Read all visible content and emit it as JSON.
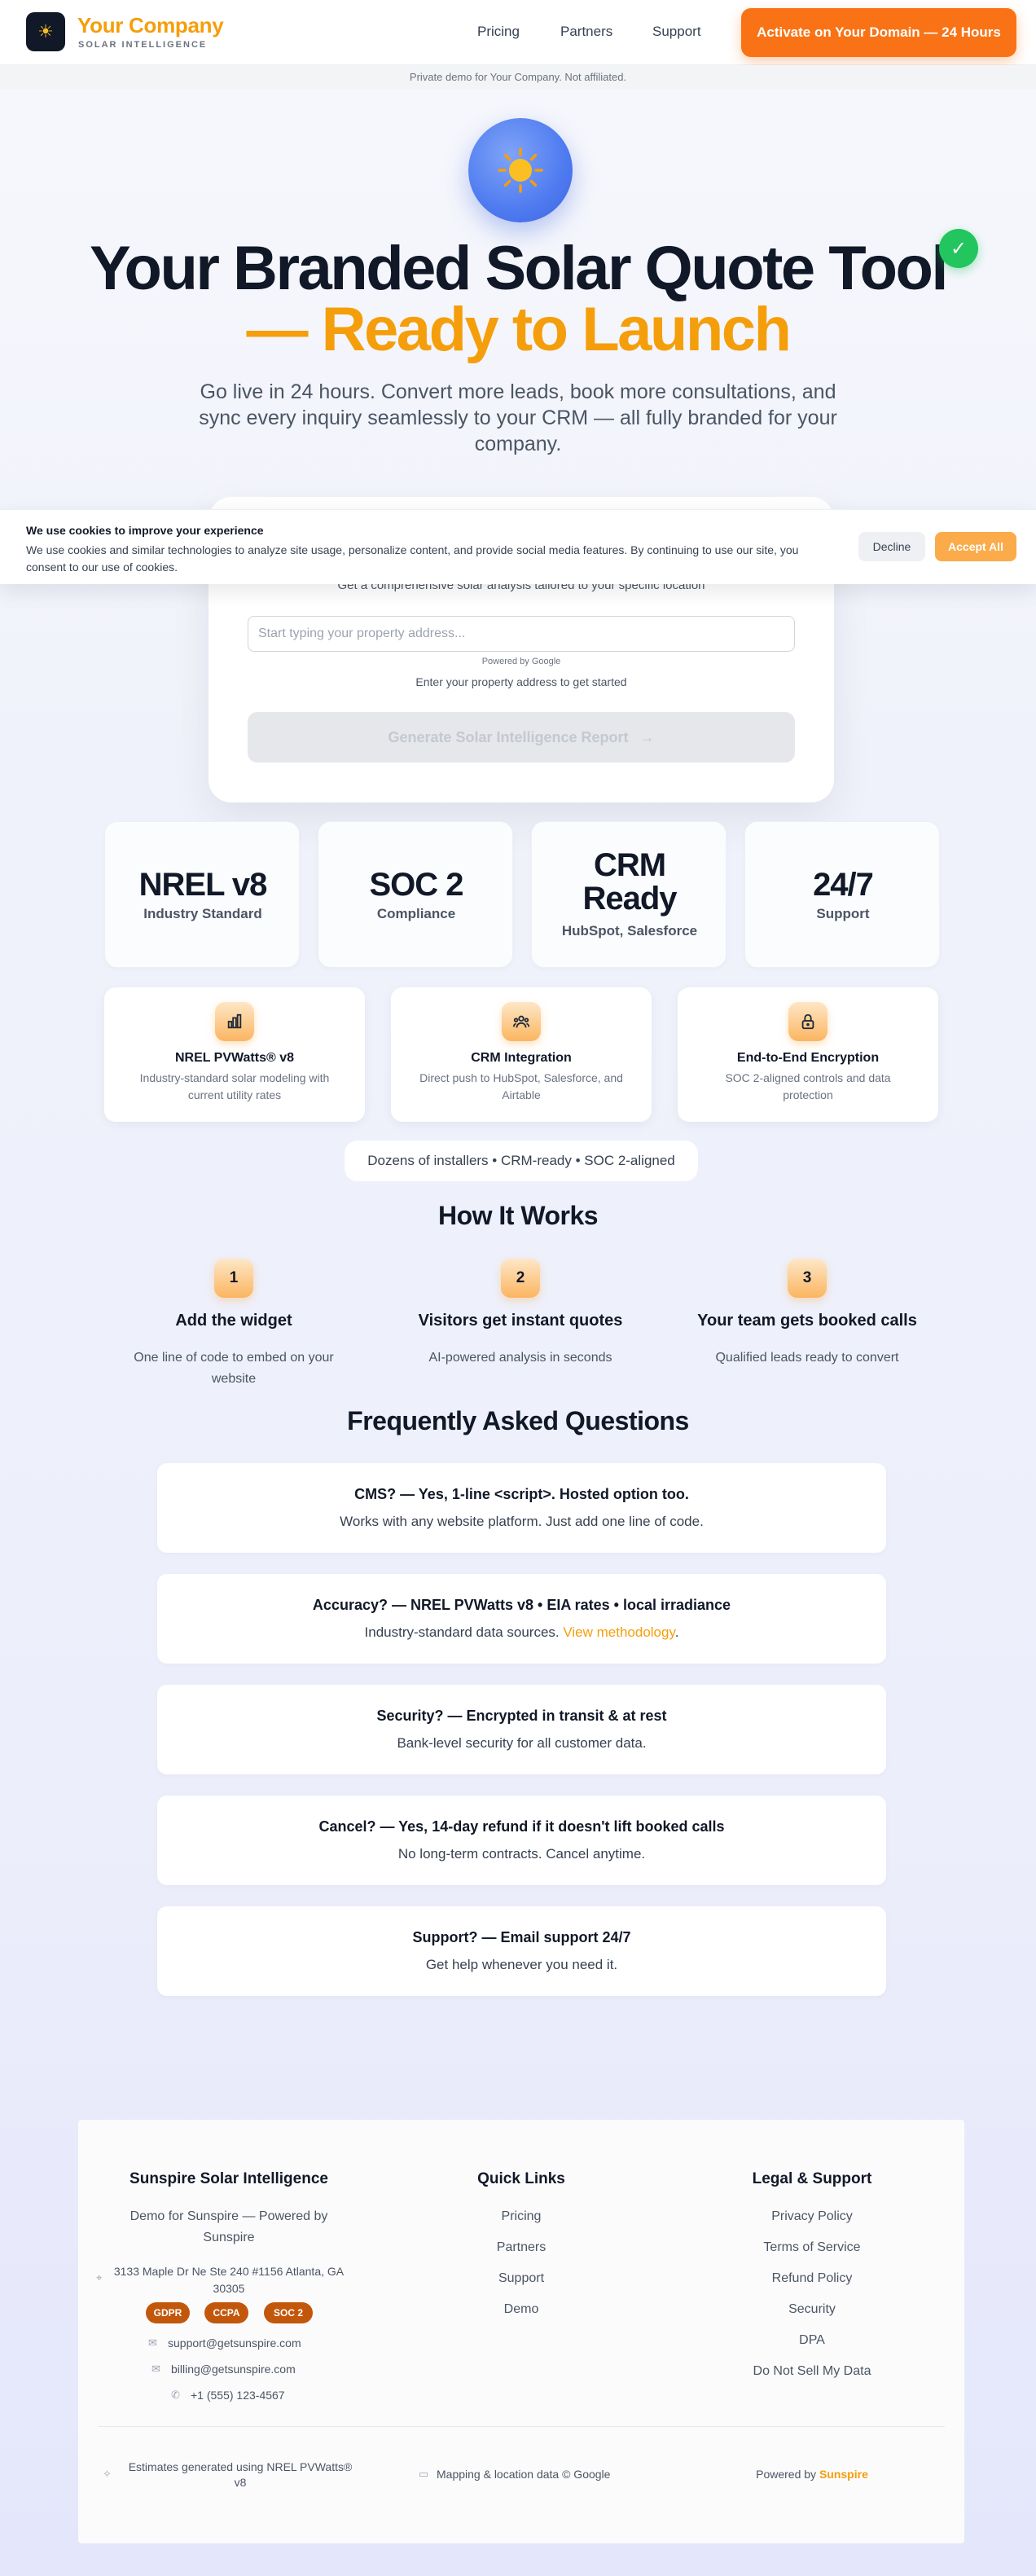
{
  "header": {
    "brand_name": "Your Company",
    "brand_sub": "SOLAR INTELLIGENCE",
    "nav": [
      "Pricing",
      "Partners",
      "Support"
    ],
    "cta": "Activate on Your Domain — 24 Hours",
    "demo_notice": "Private demo for Your Company. Not affiliated."
  },
  "hero": {
    "title_line1": "Your Branded Solar Quote Tool",
    "title_line2": "— Ready to Launch",
    "subtitle": "Go live in 24 hours. Convert more leads, book more consultations, and sync every inquiry seamlessly to your CRM — all fully branded for your company.",
    "check": "✓"
  },
  "form": {
    "subtitle": "Get a comprehensive solar analysis tailored to your specific location",
    "address_placeholder": "Start typing your property address...",
    "powered_by": "Powered by Google",
    "hint": "Enter your property address to get started",
    "button_label": "Generate Solar Intelligence Report",
    "button_arrow": "→"
  },
  "cookie": {
    "title": "We use cookies to improve your experience",
    "text": "We use cookies and similar technologies to analyze site usage, personalize content, and provide social media features. By continuing to use our site, you consent to our use of cookies.",
    "decline": "Decline",
    "accept": "Accept All"
  },
  "stats": [
    {
      "value": "NREL v8",
      "label": "Industry Standard"
    },
    {
      "value": "SOC 2",
      "label": "Compliance"
    },
    {
      "value_line1": "CRM",
      "value_line2": "Ready",
      "label": "HubSpot, Salesforce"
    },
    {
      "value": "24/7",
      "label": "Support"
    }
  ],
  "features": [
    {
      "icon": "bar-chart-icon",
      "title": "NREL PVWatts® v8",
      "desc": "Industry-standard solar modeling with current utility rates"
    },
    {
      "icon": "users-icon",
      "title": "CRM Integration",
      "desc": "Direct push to HubSpot, Salesforce, and Airtable"
    },
    {
      "icon": "lock-icon",
      "title": "End-to-End Encryption",
      "desc": "SOC 2-aligned controls and data protection"
    }
  ],
  "trust": "Dozens of installers • CRM-ready • SOC 2-aligned",
  "how": {
    "title": "How It Works",
    "steps": [
      {
        "num": "1",
        "title": "Add the widget",
        "desc": "One line of code to embed on your website"
      },
      {
        "num": "2",
        "title": "Visitors get instant quotes",
        "desc": "AI-powered analysis in seconds"
      },
      {
        "num": "3",
        "title": "Your team gets booked calls",
        "desc": "Qualified leads ready to convert"
      }
    ]
  },
  "faq": {
    "title": "Frequently Asked Questions",
    "items": [
      {
        "q": "CMS? — Yes, 1-line <script>. Hosted option too.",
        "a": "Works with any website platform. Just add one line of code."
      },
      {
        "q": "Accuracy? — NREL PVWatts v8 • EIA rates • local irradiance",
        "a": "Industry-standard data sources.",
        "link": "View methodology",
        "after": "."
      },
      {
        "q": "Security? — Encrypted in transit & at rest",
        "a": "Bank-level security for all customer data."
      },
      {
        "q": "Cancel? — Yes, 14-day refund if it doesn't lift booked calls",
        "a": "No long-term contracts. Cancel anytime."
      },
      {
        "q": "Support? — Email support 24/7",
        "a": "Get help whenever you need it."
      }
    ]
  },
  "footer": {
    "company": {
      "title": "Sunspire Solar Intelligence",
      "desc_line1": "Demo for Sunspire — Powered by",
      "desc_line2": "Sunspire",
      "address_line1": "3133 Maple Dr Ne Ste 240 #1156 Atlanta, GA",
      "address_line2": "30305",
      "badges": [
        "GDPR",
        "CCPA",
        "SOC 2"
      ],
      "email_support": "support@getsunspire.com",
      "email_billing": "billing@getsunspire.com",
      "phone": "+1 (555) 123-4567"
    },
    "quick_links": {
      "title": "Quick Links",
      "items": [
        "Pricing",
        "Partners",
        "Support",
        "Demo"
      ]
    },
    "legal": {
      "title": "Legal & Support",
      "items": [
        "Privacy Policy",
        "Terms of Service",
        "Refund Policy",
        "Security",
        "DPA",
        "Do Not Sell My Data"
      ]
    },
    "bottom": {
      "estimates_line1": "Estimates generated using NREL PVWatts®",
      "estimates_line2": "v8",
      "mapping": "Mapping & location data © Google",
      "powered_prefix": "Powered by",
      "powered_brand": "Sunspire"
    }
  }
}
